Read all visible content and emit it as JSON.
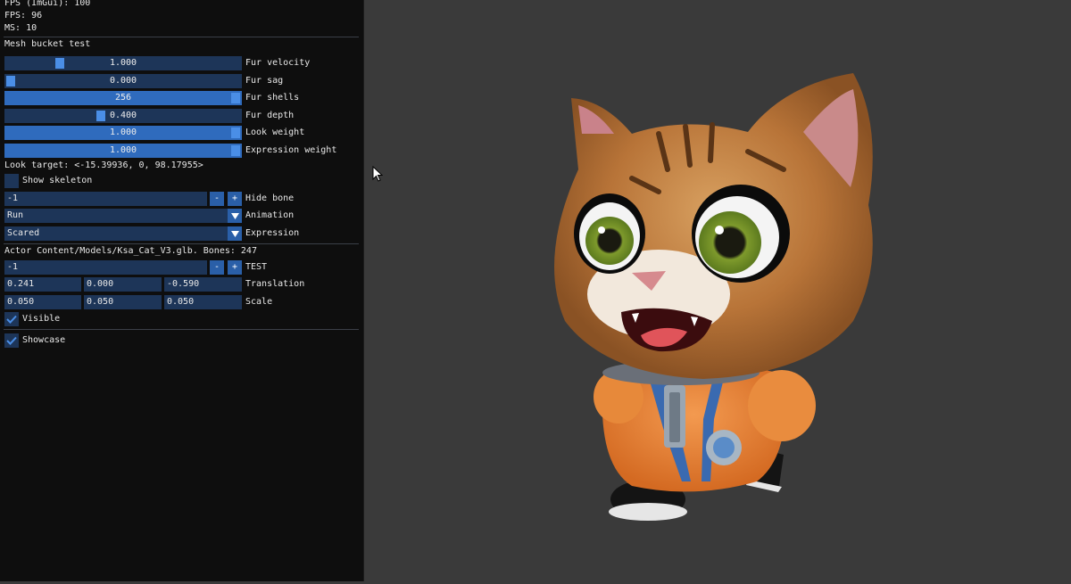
{
  "stats": {
    "fps_imgui": "FPS (ImGui): 100",
    "fps": "FPS: 96",
    "ms": "MS: 10"
  },
  "section1_title": "Mesh bucket test",
  "sliders": [
    {
      "label": "Fur velocity",
      "value": "1.000",
      "fraction": 0.22
    },
    {
      "label": "Fur sag",
      "value": "0.000",
      "fraction": 0.0
    },
    {
      "label": "Fur shells",
      "value": "256",
      "fraction": 1.0
    },
    {
      "label": "Fur depth",
      "value": "0.400",
      "fraction": 0.4
    },
    {
      "label": "Look weight",
      "value": "1.000",
      "fraction": 1.0
    },
    {
      "label": "Expression weight",
      "value": "1.000",
      "fraction": 1.0
    }
  ],
  "look_target": "Look target: <-15.39936, 0, 98.17955>",
  "show_skeleton": {
    "label": "Show skeleton",
    "checked": false
  },
  "hide_bone": {
    "value": "-1",
    "label": "Hide bone",
    "minus": "-",
    "plus": "+"
  },
  "animation": {
    "value": "Run",
    "label": "Animation"
  },
  "expression": {
    "value": "Scared",
    "label": "Expression"
  },
  "actor_line": "Actor Content/Models/Ksa_Cat_V3.glb. Bones: 247",
  "test": {
    "value": "-1",
    "label": "TEST",
    "minus": "-",
    "plus": "+"
  },
  "translation": {
    "x": "0.241",
    "y": "0.000",
    "z": "-0.590",
    "label": "Translation"
  },
  "scale": {
    "x": "0.050",
    "y": "0.050",
    "z": "0.050",
    "label": "Scale"
  },
  "visible": {
    "label": "Visible",
    "checked": true
  },
  "showcase": {
    "label": "Showcase",
    "checked": true
  },
  "colors": {
    "panel_bg": "#0e0e0e",
    "widget_bg": "#1d3558",
    "accent": "#2f6bbd",
    "viewport_bg": "#3a3a3a"
  }
}
